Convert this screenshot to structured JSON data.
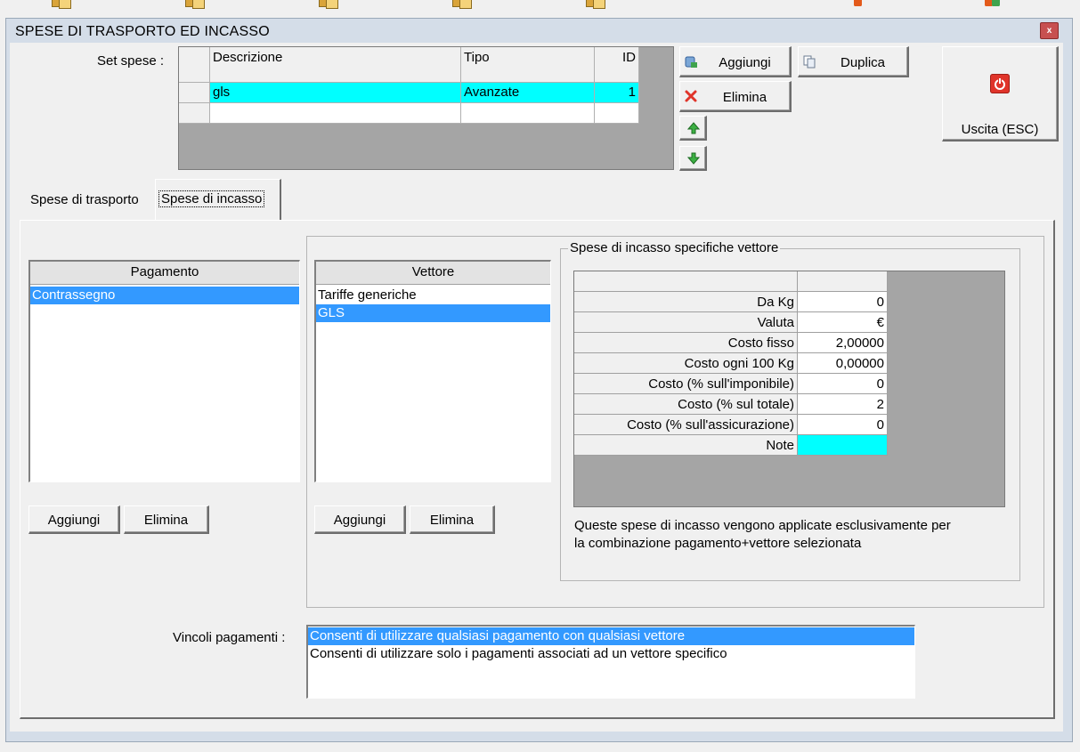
{
  "window": {
    "title": "SPESE DI TRASPORTO ED INCASSO",
    "close_glyph": "x"
  },
  "taskbar_icons": [
    "folder-people-icon",
    "folder-people-icon",
    "folder-people-icon",
    "folder-people-icon",
    "folder-people-icon",
    "user-icon",
    "users-icon"
  ],
  "set_spese": {
    "label": "Set spese :",
    "columns": [
      "Descrizione",
      "Tipo",
      "ID"
    ],
    "rows": [
      {
        "descrizione": "gls",
        "tipo": "Avanzate",
        "id": "1"
      }
    ]
  },
  "toolbar": {
    "aggiungi": "Aggiungi",
    "duplica": "Duplica",
    "elimina": "Elimina",
    "uscita": "Uscita (ESC)"
  },
  "tabs": [
    {
      "label": "Spese di trasporto",
      "active": false
    },
    {
      "label": "Spese di incasso",
      "active": true
    }
  ],
  "pagamento": {
    "header": "Pagamento",
    "items": [
      "Contrassegno"
    ],
    "selected_index": 0,
    "add": "Aggiungi",
    "delete": "Elimina"
  },
  "vettore": {
    "header": "Vettore",
    "items": [
      "Tariffe generiche",
      "GLS"
    ],
    "selected_index": 1,
    "add": "Aggiungi",
    "delete": "Elimina"
  },
  "specifiche": {
    "title": "Spese di incasso specifiche vettore",
    "rows": [
      {
        "label": "Da Kg",
        "value": "0"
      },
      {
        "label": "Valuta",
        "value": "€"
      },
      {
        "label": "Costo fisso",
        "value": "2,00000"
      },
      {
        "label": "Costo ogni 100 Kg",
        "value": "0,00000"
      },
      {
        "label": "Costo (% sull'imponibile)",
        "value": "0"
      },
      {
        "label": "Costo (% sul totale)",
        "value": "2"
      },
      {
        "label": "Costo (% sull'assicurazione)",
        "value": "0"
      },
      {
        "label": "Note",
        "value": ""
      }
    ],
    "note_line1": "Queste spese di incasso vengono applicate esclusivamente per",
    "note_line2": "la combinazione pagamento+vettore selezionata"
  },
  "vincoli": {
    "label": "Vincoli pagamenti :",
    "options": [
      "Consenti di utilizzare qualsiasi pagamento con qualsiasi vettore",
      "Consenti di utilizzare solo i pagamenti associati ad un vettore specifico"
    ],
    "selected_index": 0
  },
  "colors": {
    "selection": "#3399ff",
    "grid_highlight": "#00ffff",
    "grid_bg": "#a5a5a5"
  }
}
